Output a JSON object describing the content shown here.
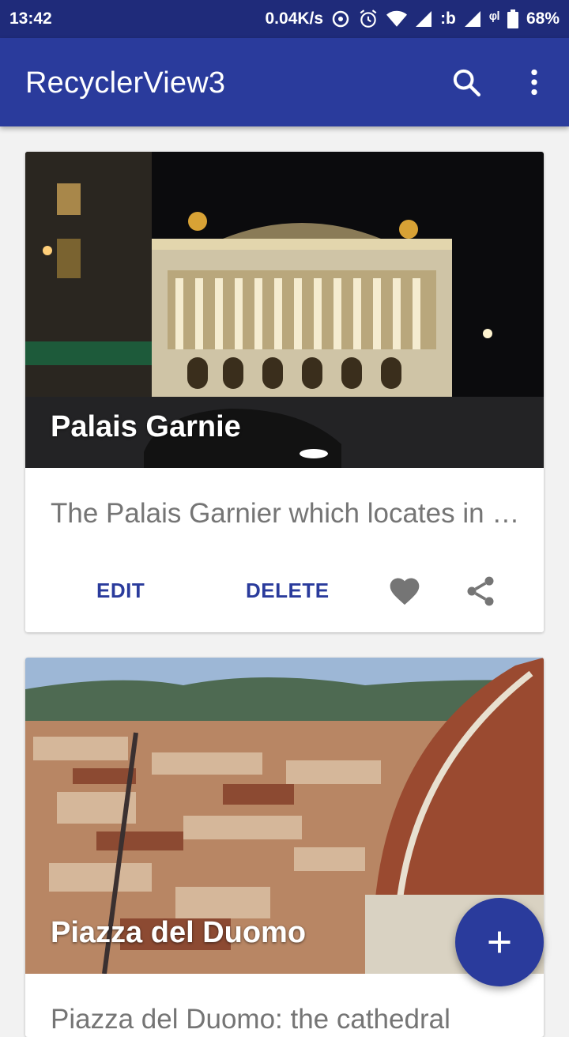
{
  "status_bar": {
    "time": "13:42",
    "net_speed": "0.04K/s",
    "carrier_b": ":b",
    "carrier_q": "ᚹ",
    "battery": "68%"
  },
  "app_bar": {
    "title": "RecyclerView3",
    "search_icon": "search-icon",
    "more_icon": "more-vert-icon"
  },
  "cards": [
    {
      "title": "Palais Garnie",
      "description": "The Palais Garnier which locates in Paris",
      "edit_label": "EDIT",
      "delete_label": "DELETE",
      "favorite_icon": "heart-icon",
      "share_icon": "share-icon"
    },
    {
      "title": "Piazza del Duomo",
      "description": "Piazza del Duomo: the cathedral"
    }
  ],
  "fab": {
    "icon": "plus-icon"
  },
  "colors": {
    "primary": "#2a3b9c",
    "primary_dark": "#1f2b7a",
    "accent": "#2a3b9c",
    "text_secondary": "#757575"
  }
}
